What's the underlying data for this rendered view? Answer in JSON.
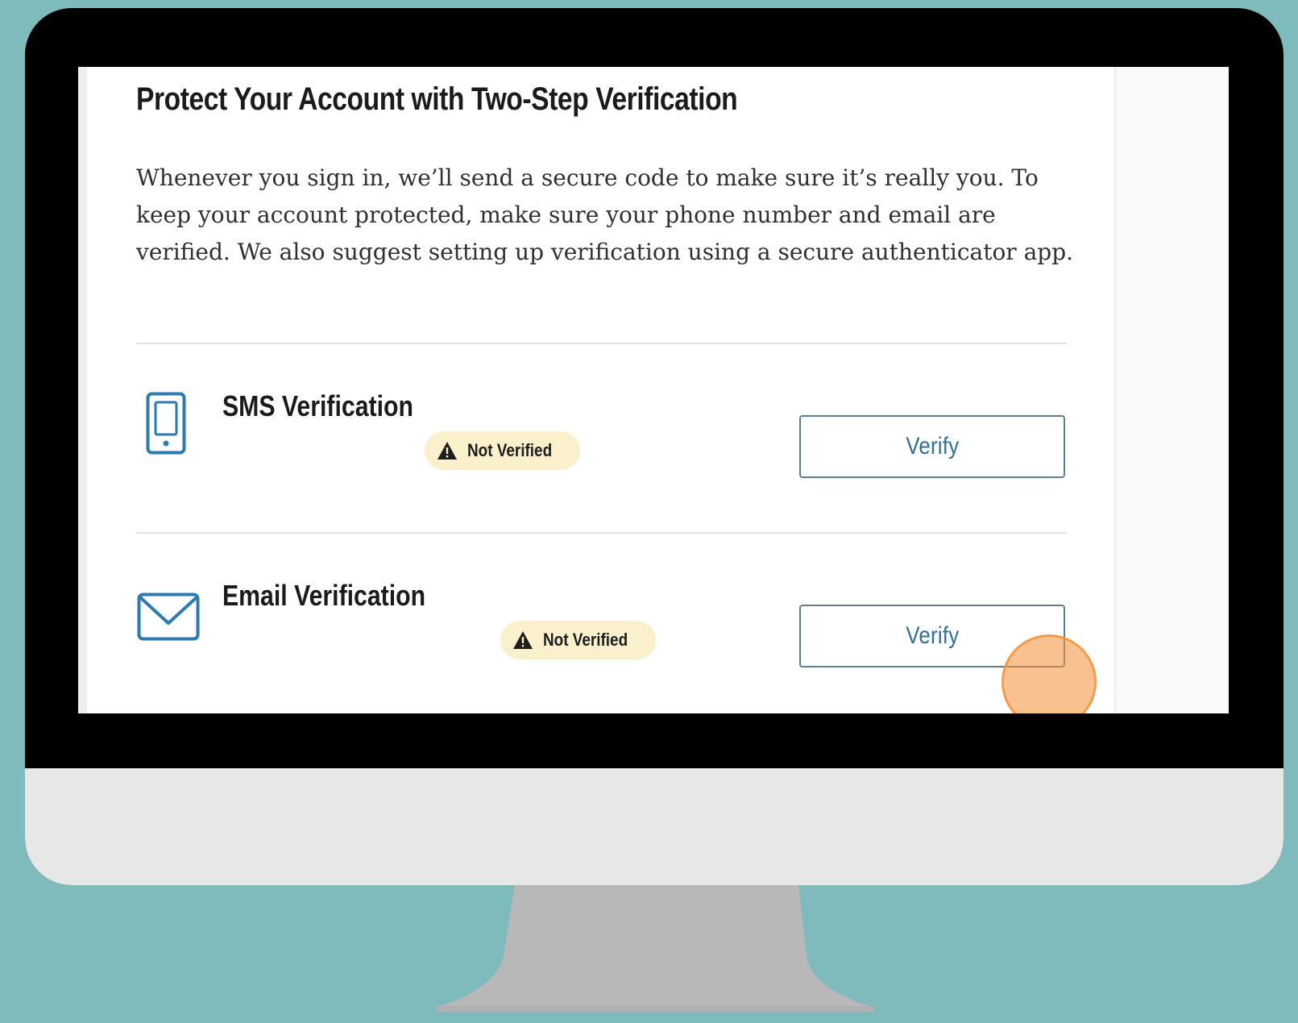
{
  "page": {
    "title": "Protect Your Account with Two-Step Verification",
    "description": "Whenever you sign in, we’ll send a secure code to make sure it’s really you. To keep your account protected, make sure your phone number and email are verified. We also suggest setting up verification using a secure authenticator app."
  },
  "methods": [
    {
      "name": "SMS Verification",
      "icon": "phone-icon",
      "status": "Not Verified",
      "status_icon": "warning-icon",
      "action_label": "Verify"
    },
    {
      "name": "Email Verification",
      "icon": "mail-icon",
      "status": "Not Verified",
      "status_icon": "warning-icon",
      "action_label": "Verify"
    }
  ],
  "colors": {
    "background": "#7fbbbc",
    "monitor_bezel": "#000000",
    "monitor_chin": "#e7e7e7",
    "monitor_stand": "#b8b8b8",
    "badge_background": "#fbf0cc",
    "button_border": "#5f7f90",
    "button_text": "#2e6f93",
    "icon_stroke": "#2d7ab0",
    "click_indicator": "#f68e34"
  }
}
